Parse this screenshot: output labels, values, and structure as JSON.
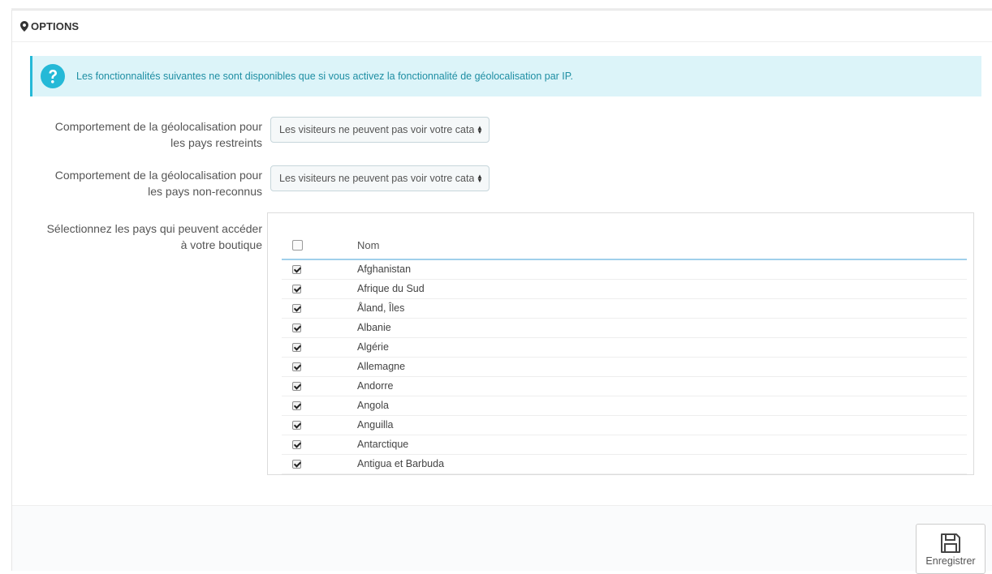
{
  "panel": {
    "title": "OPTIONS",
    "title_icon": "map-marker-icon"
  },
  "alert": {
    "icon": "question-circle-icon",
    "text": "Les fonctionnalités suivantes ne sont disponibles que si vous activez la fonctionnalité de géolocalisation par IP."
  },
  "fields": {
    "restricted": {
      "label_line1": "Comportement de la géolocalisation pour",
      "label_line2": "les pays restreints",
      "value": "Les visiteurs ne peuvent pas voir votre catalogue."
    },
    "unrecognized": {
      "label_line1": "Comportement de la géolocalisation pour",
      "label_line2": "les pays non-reconnus",
      "value": "Les visiteurs ne peuvent pas voir votre catalogue."
    },
    "countries": {
      "label_line1": "Sélectionnez les pays qui peuvent accéder",
      "label_line2": "à votre boutique"
    }
  },
  "table": {
    "header_name": "Nom",
    "rows": [
      {
        "name": "Afghanistan",
        "checked": true
      },
      {
        "name": "Afrique du Sud",
        "checked": true
      },
      {
        "name": "Åland, Îles",
        "checked": true
      },
      {
        "name": "Albanie",
        "checked": true
      },
      {
        "name": "Algérie",
        "checked": true
      },
      {
        "name": "Allemagne",
        "checked": true
      },
      {
        "name": "Andorre",
        "checked": true
      },
      {
        "name": "Angola",
        "checked": true
      },
      {
        "name": "Anguilla",
        "checked": true
      },
      {
        "name": "Antarctique",
        "checked": true
      },
      {
        "name": "Antigua et Barbuda",
        "checked": true
      }
    ]
  },
  "footer": {
    "save_label": "Enregistrer",
    "save_icon": "floppy-disk-icon"
  },
  "colors": {
    "accent": "#25b9d7",
    "alert_bg": "#dcf4f9",
    "alert_text": "#1e8ea3"
  }
}
